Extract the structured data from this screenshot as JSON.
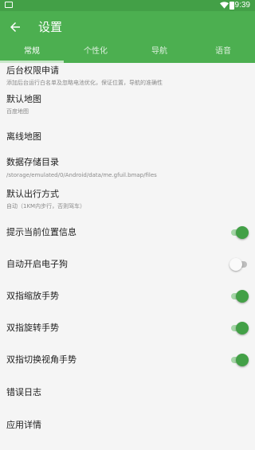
{
  "status_bar": {
    "time": "9:39",
    "icons": [
      "notification-icon",
      "wifi-icon",
      "battery-icon"
    ]
  },
  "app_bar": {
    "title": "设置",
    "back_icon": "arrow-left-icon"
  },
  "tabs": [
    {
      "label": "常规",
      "active": true
    },
    {
      "label": "个性化",
      "active": false
    },
    {
      "label": "导航",
      "active": false
    },
    {
      "label": "语音",
      "active": false
    }
  ],
  "settings": {
    "background_permission": {
      "title": "后台权限申请",
      "subtitle": "添加后台运行白名单及忽略电池优化，保证位置，导航的准确性"
    },
    "default_map": {
      "title": "默认地图",
      "subtitle": "百度地图"
    },
    "offline_map": {
      "title": "离线地图"
    },
    "data_storage": {
      "title": "数据存储目录",
      "subtitle": "/storage/emulated/0/Android/data/me.gfuil.bmap/files"
    },
    "default_travel": {
      "title": "默认出行方式",
      "subtitle": "自动（1KM内步行，否则驾车）"
    },
    "location_info": {
      "title": "提示当前位置信息",
      "enabled": true
    },
    "auto_dog": {
      "title": "自动开启电子狗",
      "enabled": false
    },
    "pinch_zoom": {
      "title": "双指缩放手势",
      "enabled": true
    },
    "rotate": {
      "title": "双指旋转手势",
      "enabled": true
    },
    "view_angle": {
      "title": "双指切换视角手势",
      "enabled": true
    },
    "error_log": {
      "title": "错误日志"
    },
    "app_details": {
      "title": "应用详情"
    }
  },
  "colors": {
    "primary": "#4caf50",
    "status_bar": "#43a047",
    "switch_on": "#43a047",
    "switch_on_track": "#a5d6a7"
  }
}
